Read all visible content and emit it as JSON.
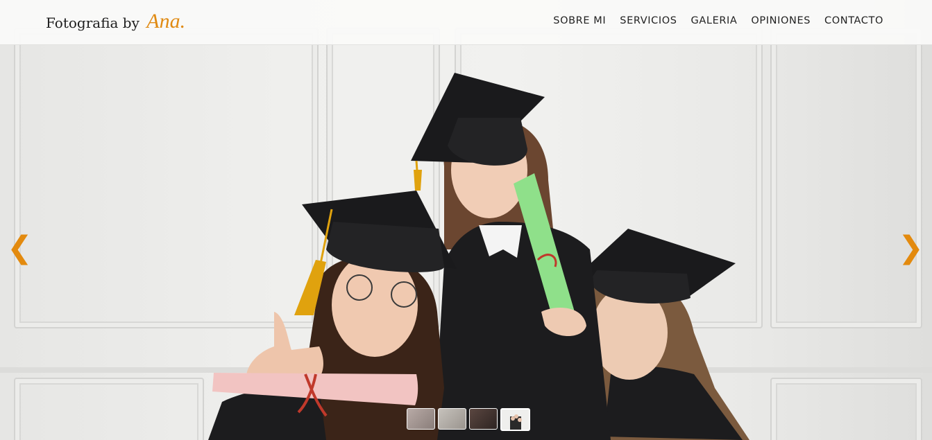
{
  "brand": {
    "prefix": "Fotografia by",
    "accent": "Ana."
  },
  "nav": {
    "items": [
      {
        "label": "SOBRE MI"
      },
      {
        "label": "SERVICIOS"
      },
      {
        "label": "GALERIA"
      },
      {
        "label": "OPINIONES"
      },
      {
        "label": "CONTACTO"
      }
    ]
  },
  "slider": {
    "prev_glyph": "❮",
    "next_glyph": "❯",
    "thumbnail_count": 4,
    "active_thumbnail": 4
  },
  "colors": {
    "accent": "#e08a12",
    "arrow": "#e38a0e",
    "header_bg": "#fafaf9",
    "gown": "#1c1c1e",
    "scroll_green": "#8fe08a",
    "scroll_pink": "#f2c4c2",
    "tassel": "#e0a20e"
  }
}
